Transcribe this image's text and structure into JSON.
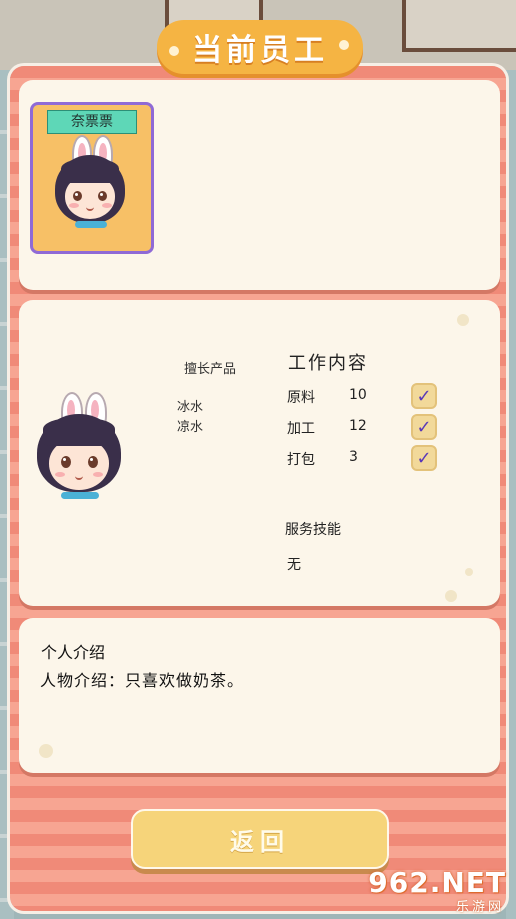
{
  "header": {
    "title": "当前员工"
  },
  "staff_card": {
    "name": "奈票票"
  },
  "details": {
    "specialty_heading": "擅长产品",
    "specialty_items": [
      "冰水",
      "凉水"
    ],
    "work_heading": "工作内容",
    "work_items": [
      {
        "label": "原料",
        "value": "10",
        "checked": true
      },
      {
        "label": "加工",
        "value": "12",
        "checked": true
      },
      {
        "label": "打包",
        "value": "3",
        "checked": true
      }
    ],
    "skill_heading": "服务技能",
    "skill_value": "无"
  },
  "intro": {
    "heading": "个人介绍",
    "text": "人物介绍：只喜欢做奶茶。"
  },
  "footer": {
    "return_label": "返回"
  },
  "watermark": {
    "brand": "962.NET",
    "sub": "乐游网"
  },
  "colors": {
    "panel_stripe_a": "#f08a78",
    "panel_stripe_b": "#f7a592",
    "card_bg": "#fcf6ea",
    "title_ribbon": "#f5b443",
    "staff_tile": "#f7c066",
    "staff_tile_border": "#8f6ad6",
    "name_tag": "#5ed7b7",
    "checkmark": "#5a39b8",
    "button": "#f6d47a"
  },
  "icons": {
    "check": "checkmark-icon"
  }
}
